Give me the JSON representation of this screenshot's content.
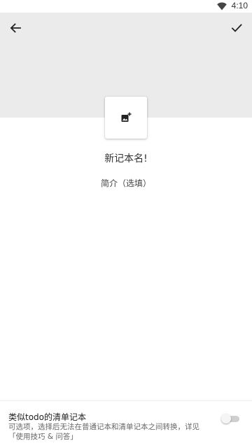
{
  "status_bar": {
    "time": "4:10",
    "wifi_icon": "wifi-icon"
  },
  "toolbar": {
    "back_icon": "arrow-back-icon",
    "confirm_icon": "check-icon"
  },
  "header": {
    "background_color": "#ebebeb"
  },
  "cover": {
    "icon": "add-photo-icon"
  },
  "notebook": {
    "name": "新记本名!",
    "description": "简介（选填）"
  },
  "todo_option": {
    "title": "类似todo的清单记本",
    "description": "可选项，选择后无法在普通记本和清单记本之间转换，详见「使用技巧 & 问答」",
    "enabled": false
  }
}
